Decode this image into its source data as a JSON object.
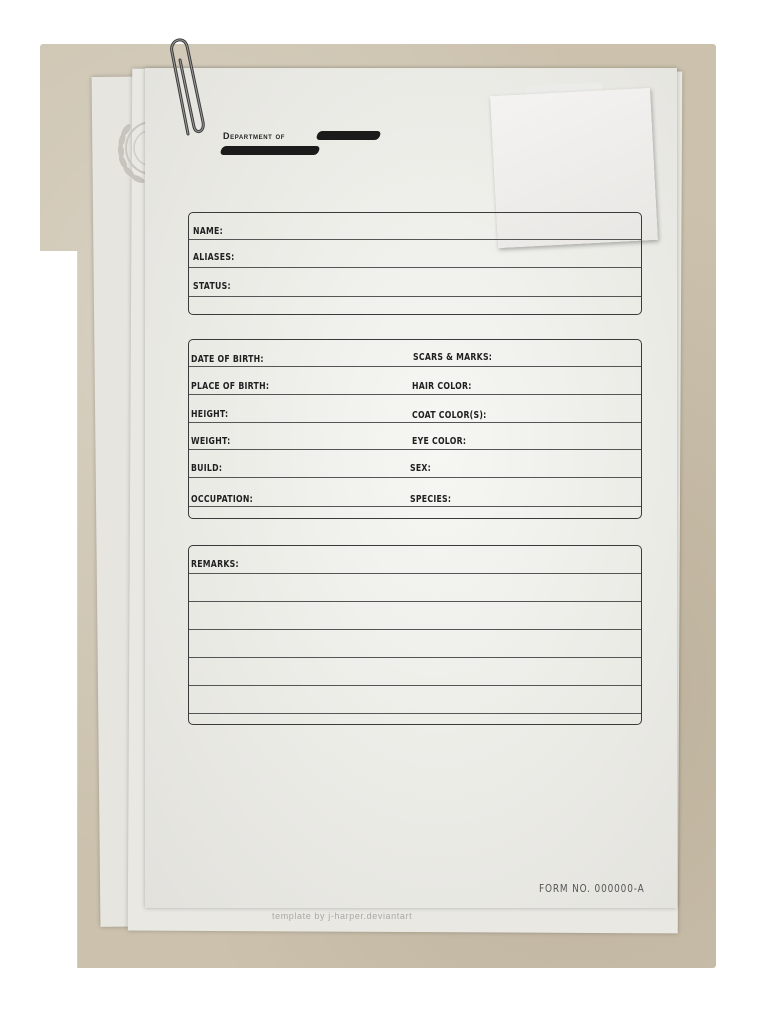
{
  "header": {
    "department_label": "Department of"
  },
  "identity": {
    "fields": [
      "NAME:",
      "ALIASES:",
      "STATUS:"
    ]
  },
  "details": {
    "left": [
      "DATE OF BIRTH:",
      "PLACE OF BIRTH:",
      "HEIGHT:",
      "WEIGHT:",
      "BUILD:",
      "OCCUPATION:"
    ],
    "right": [
      "SCARS & MARKS:",
      "HAIR COLOR:",
      "COAT COLOR(S):",
      "EYE COLOR:",
      "SEX:",
      "SPECIES:"
    ]
  },
  "remarks": {
    "label": "REMARKS:"
  },
  "footer": {
    "form_number": "FORM NO. 000000-A",
    "credit": "template by j-harper.deviantart"
  },
  "icons": {
    "paperclip": "paperclip-icon",
    "emblem": "laurel-emblem-icon"
  }
}
